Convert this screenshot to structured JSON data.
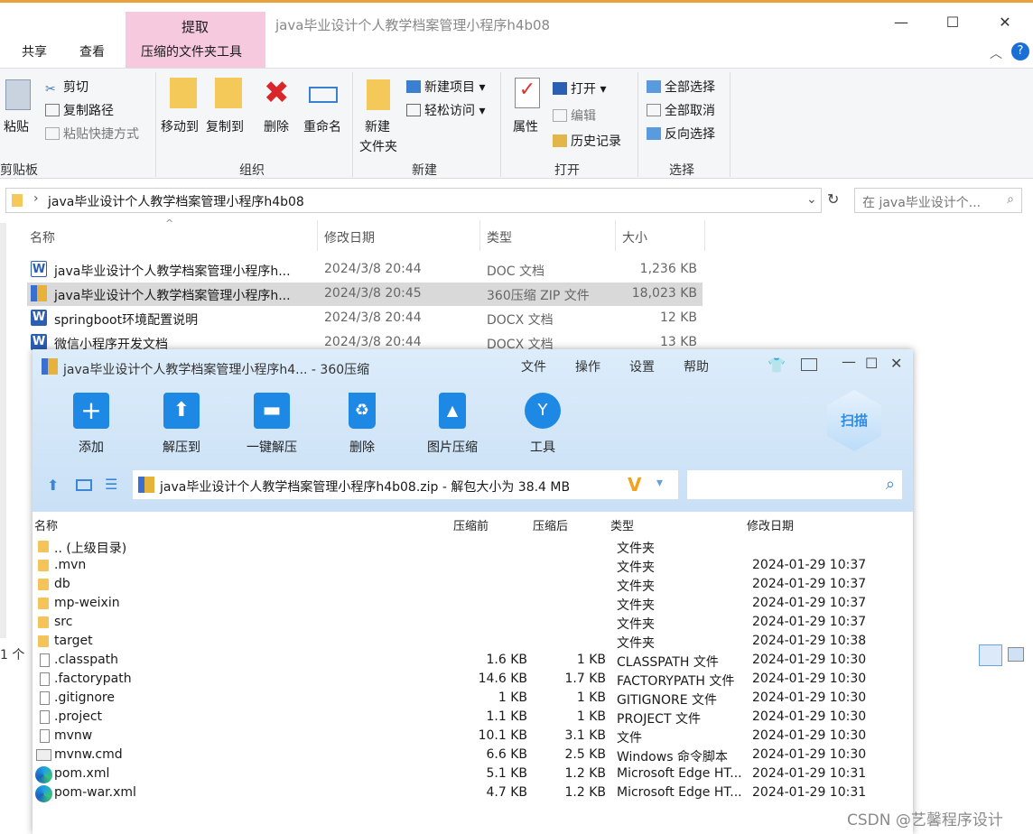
{
  "explorer": {
    "title": "java毕业设计个人教学档案管理小程序h4b08",
    "context_tab": "提取",
    "tabs": [
      "共享",
      "查看",
      "压缩的文件夹工具"
    ],
    "ribbon": {
      "clipboard": {
        "paste": "粘贴",
        "cut": "剪切",
        "copy_path": "复制路径",
        "paste_shortcut": "粘贴快捷方式",
        "label": "剪贴板"
      },
      "organize": {
        "move_to": "移动到",
        "copy_to": "复制到",
        "delete": "删除",
        "rename": "重命名",
        "label": "组织"
      },
      "new": {
        "new_folder_1": "新建",
        "new_folder_2": "文件夹",
        "new_item": "新建项目",
        "easy_access": "轻松访问",
        "label": "新建"
      },
      "open": {
        "properties": "属性",
        "open": "打开",
        "edit": "编辑",
        "history": "历史记录",
        "label": "打开"
      },
      "select": {
        "select_all": "全部选择",
        "select_none": "全部取消",
        "invert": "反向选择",
        "label": "选择"
      }
    },
    "address": "java毕业设计个人教学档案管理小程序h4b08",
    "search_placeholder": "在 java毕业设计个...",
    "columns": {
      "name": "名称",
      "date": "修改日期",
      "type": "类型",
      "size": "大小"
    },
    "files": [
      {
        "name": "java毕业设计个人教学档案管理小程序h...",
        "date": "2024/3/8 20:44",
        "type": "DOC 文档",
        "size": "1,236 KB"
      },
      {
        "name": "java毕业设计个人教学档案管理小程序h...",
        "date": "2024/3/8 20:45",
        "type": "360压缩 ZIP 文件",
        "size": "18,023 KB"
      },
      {
        "name": "springboot环境配置说明",
        "date": "2024/3/8 20:44",
        "type": "DOCX 文档",
        "size": "12 KB"
      },
      {
        "name": "微信小程序开发文档",
        "date": "2024/3/8 20:44",
        "type": "DOCX 文档",
        "size": "13 KB"
      }
    ],
    "status": "1 个"
  },
  "zip": {
    "title": "java毕业设计个人教学档案管理小程序h4... - 360压缩",
    "menu": [
      "文件",
      "操作",
      "设置",
      "帮助"
    ],
    "toolbar": [
      "添加",
      "解压到",
      "一键解压",
      "删除",
      "图片压缩",
      "工具"
    ],
    "scan": "扫描",
    "path": "java毕业设计个人教学档案管理小程序h4b08.zip - 解包大小为 38.4 MB",
    "columns": {
      "name": "名称",
      "before": "压缩前",
      "after": "压缩后",
      "type": "类型",
      "date": "修改日期"
    },
    "rows": [
      {
        "name": ".. (上级目录)",
        "before": "",
        "after": "",
        "type": "文件夹",
        "date": "",
        "icon": "folder"
      },
      {
        "name": ".mvn",
        "before": "",
        "after": "",
        "type": "文件夹",
        "date": "2024-01-29 10:37",
        "icon": "folder"
      },
      {
        "name": "db",
        "before": "",
        "after": "",
        "type": "文件夹",
        "date": "2024-01-29 10:37",
        "icon": "folder"
      },
      {
        "name": "mp-weixin",
        "before": "",
        "after": "",
        "type": "文件夹",
        "date": "2024-01-29 10:37",
        "icon": "folder"
      },
      {
        "name": "src",
        "before": "",
        "after": "",
        "type": "文件夹",
        "date": "2024-01-29 10:37",
        "icon": "folder"
      },
      {
        "name": "target",
        "before": "",
        "after": "",
        "type": "文件夹",
        "date": "2024-01-29 10:38",
        "icon": "folder"
      },
      {
        "name": ".classpath",
        "before": "1.6 KB",
        "after": "1 KB",
        "type": "CLASSPATH 文件",
        "date": "2024-01-29 10:30",
        "icon": "doc"
      },
      {
        "name": ".factorypath",
        "before": "14.6 KB",
        "after": "1.7 KB",
        "type": "FACTORYPATH 文件",
        "date": "2024-01-29 10:30",
        "icon": "doc"
      },
      {
        "name": ".gitignore",
        "before": "1 KB",
        "after": "1 KB",
        "type": "GITIGNORE 文件",
        "date": "2024-01-29 10:30",
        "icon": "doc"
      },
      {
        "name": ".project",
        "before": "1.1 KB",
        "after": "1 KB",
        "type": "PROJECT 文件",
        "date": "2024-01-29 10:30",
        "icon": "doc"
      },
      {
        "name": "mvnw",
        "before": "10.1 KB",
        "after": "3.1 KB",
        "type": "文件",
        "date": "2024-01-29 10:30",
        "icon": "doc"
      },
      {
        "name": "mvnw.cmd",
        "before": "6.6 KB",
        "after": "2.5 KB",
        "type": "Windows 命令脚本",
        "date": "2024-01-29 10:30",
        "icon": "cmd"
      },
      {
        "name": "pom.xml",
        "before": "5.1 KB",
        "after": "1.2 KB",
        "type": "Microsoft Edge HT...",
        "date": "2024-01-29 10:31",
        "icon": "edge"
      },
      {
        "name": "pom-war.xml",
        "before": "4.7 KB",
        "after": "1.2 KB",
        "type": "Microsoft Edge HT...",
        "date": "2024-01-29 10:31",
        "icon": "edge"
      }
    ]
  },
  "watermark": "CSDN @艺馨程序设计"
}
